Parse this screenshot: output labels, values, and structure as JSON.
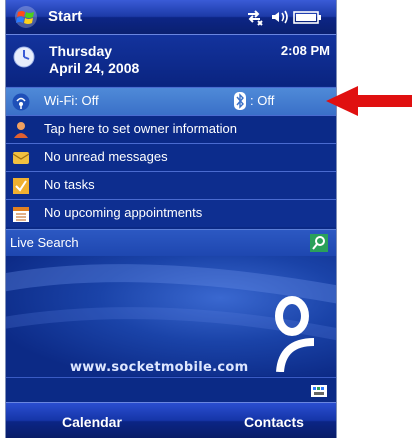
{
  "titlebar": {
    "title": "Start"
  },
  "today": {
    "day": "Thursday",
    "date": "April 24, 2008",
    "time": "2:08 PM"
  },
  "rows": [
    {
      "label": "Wi-Fi: Off",
      "icon": "wifi-icon"
    },
    {
      "label": "Tap here to set owner information",
      "icon": "owner-icon"
    },
    {
      "label": "No unread messages",
      "icon": "messages-icon"
    },
    {
      "label": "No tasks",
      "icon": "tasks-icon"
    },
    {
      "label": "No upcoming appointments",
      "icon": "calendar-icon"
    }
  ],
  "bluetooth": {
    "label": ": Off",
    "icon": "bluetooth-icon"
  },
  "search": {
    "label": "Live Search",
    "icon": "search-icon"
  },
  "wallpaper": {
    "url": "www.socketmobile.com"
  },
  "softkeys": {
    "left": "Calendar",
    "right": "Contacts"
  },
  "colors": {
    "accent": "#0b2a86",
    "highlight": "#3a70c8",
    "arrow": "#e01010"
  }
}
